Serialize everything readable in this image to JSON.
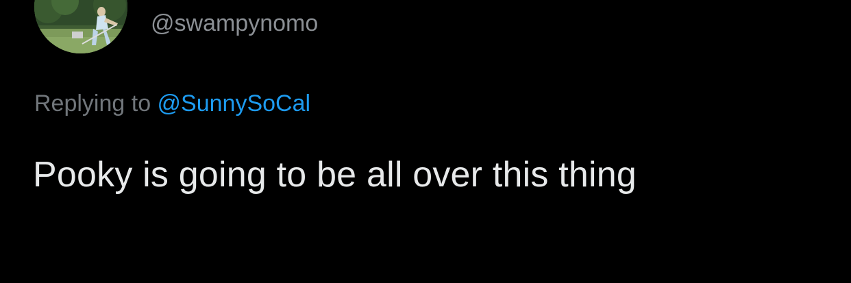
{
  "tweet": {
    "avatar_icon": "profile-photo-golfer",
    "handle": "@swampynomo",
    "replying_label": "Replying to",
    "replying_target": "@SunnySoCal",
    "text": "Pooky is going to be all over this thing"
  },
  "colors": {
    "background": "#000000",
    "primary_text": "#e7e9ea",
    "secondary_text": "#71767b",
    "link": "#1d9bf0"
  }
}
